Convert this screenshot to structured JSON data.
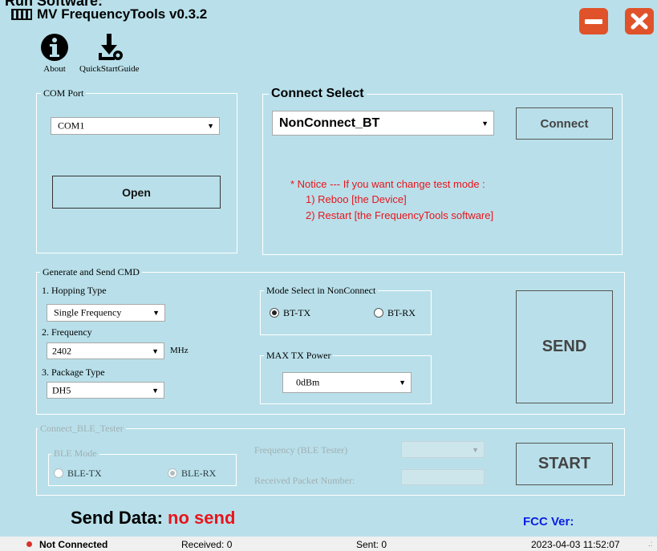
{
  "page_heading": "Run Software:",
  "window": {
    "title": "MV FrequencyTools v0.3.2"
  },
  "toolbar": {
    "about_label": "About",
    "quickstart_label": "QuickStartGuide"
  },
  "com_port": {
    "group_label": "COM Port",
    "selected": "COM1",
    "open_label": "Open"
  },
  "connect_select": {
    "group_label": "Connect Select",
    "selected": "NonConnect_BT",
    "connect_label": "Connect",
    "notice": [
      "* Notice --- If you want change test mode :",
      "1) Reboo [the Device]",
      "2) Restart [the FrequencyTools software]"
    ]
  },
  "generate": {
    "group_label": "Generate and Send CMD",
    "hopping_label": "1. Hopping Type",
    "hopping_value": "Single Frequency",
    "frequency_label": "2. Frequency",
    "frequency_value": "2402",
    "frequency_unit": "MHz",
    "package_label": "3. Package Type",
    "package_value": "DH5",
    "mode_group_label": "Mode Select in NonConnect",
    "mode_options": [
      "BT-TX",
      "BT-RX"
    ],
    "mode_selected": "BT-TX",
    "power_group_label": "MAX TX Power",
    "power_value": "0dBm",
    "send_label": "SEND"
  },
  "ble": {
    "group_label": "Connect_BLE_Tester",
    "mode_group_label": "BLE Mode",
    "mode_options": [
      "BLE-TX",
      "BLE-RX"
    ],
    "mode_selected": "BLE-RX",
    "frequency_label": "Frequency (BLE Tester)",
    "received_label": "Received Packet Number:",
    "start_label": "START"
  },
  "send_data": {
    "label": "Send Data:",
    "value": "no send"
  },
  "fcc_label": "FCC Ver:",
  "status_bar": {
    "connection": "Not Connected",
    "received": "Received: 0",
    "sent": "Sent: 0",
    "timestamp": "2023-04-03 11:52:07"
  },
  "colors": {
    "background": "#b9e0ea",
    "minimize_button": "#e0522a",
    "close_button": "#e0522a",
    "notice_text": "#e8141c",
    "send_data_value": "#e8141c",
    "fcc_text": "#0a1ee0",
    "status_dot": "#d9322a"
  }
}
